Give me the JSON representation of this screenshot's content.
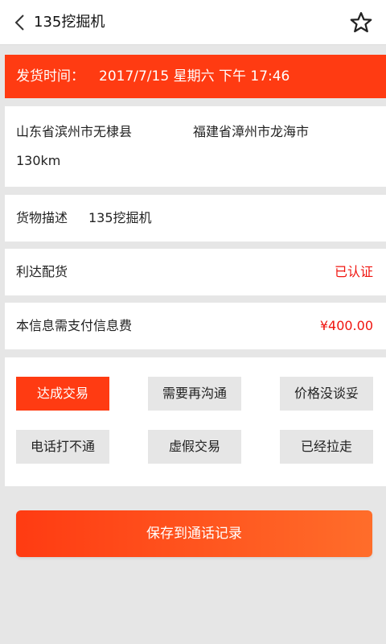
{
  "header": {
    "title": "135挖掘机",
    "back_icon": "chevron-left-icon",
    "favorite_icon": "star-outline-icon"
  },
  "shipping": {
    "label": "发货时间：",
    "datetime": "2017/7/15 星期六 下午 17:46",
    "color": "#ff3b12"
  },
  "route": {
    "from": "山东省滨州市无棣县",
    "to": "福建省漳州市龙海市",
    "distance": "130km"
  },
  "cargo": {
    "label": "货物描述",
    "value": "135挖掘机"
  },
  "company": {
    "name": "利达配货",
    "status": "已认证",
    "status_color": "#f0140f"
  },
  "fee": {
    "label": "本信息需支付信息费",
    "amount": "¥400.00"
  },
  "tags": [
    "达成交易",
    "需要再沟通",
    "价格没谈妥",
    "电话打不通",
    "虚假交易",
    "已经拉走"
  ],
  "selected_tag": "达成交易",
  "save_button": {
    "label": "保存到通话记录"
  }
}
